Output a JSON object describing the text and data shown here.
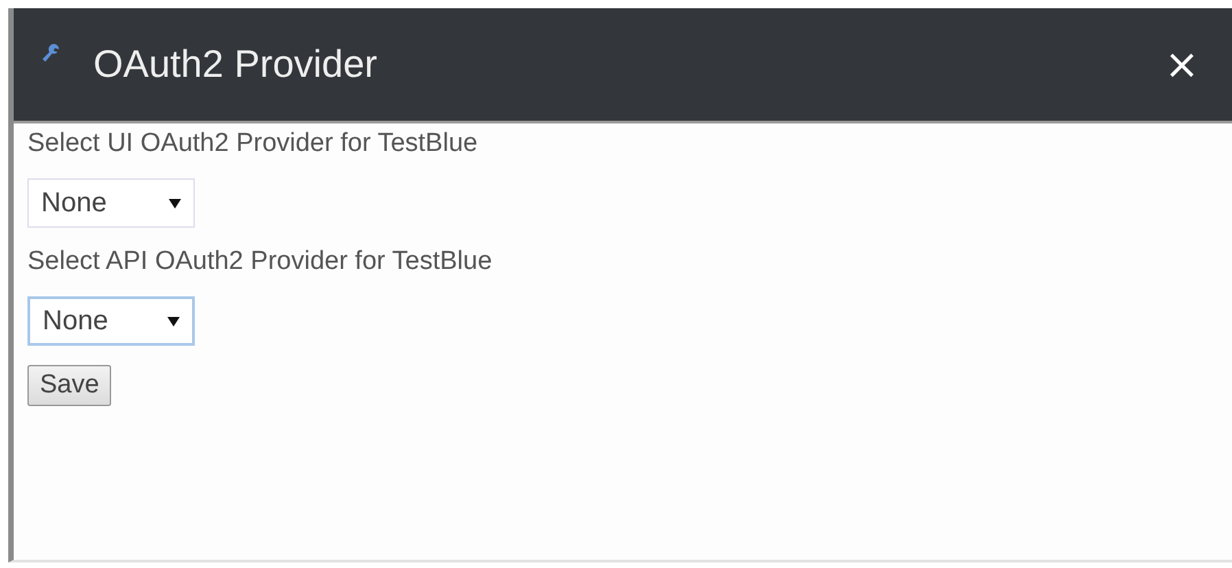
{
  "dialog": {
    "title": "OAuth2 Provider",
    "close": "×"
  },
  "fields": [
    {
      "label": "Select UI OAuth2 Provider for TestBlue",
      "value": "None",
      "focused": false
    },
    {
      "label": "Select API OAuth2 Provider for TestBlue",
      "value": "None",
      "focused": true
    }
  ],
  "buttons": [
    "Save"
  ]
}
